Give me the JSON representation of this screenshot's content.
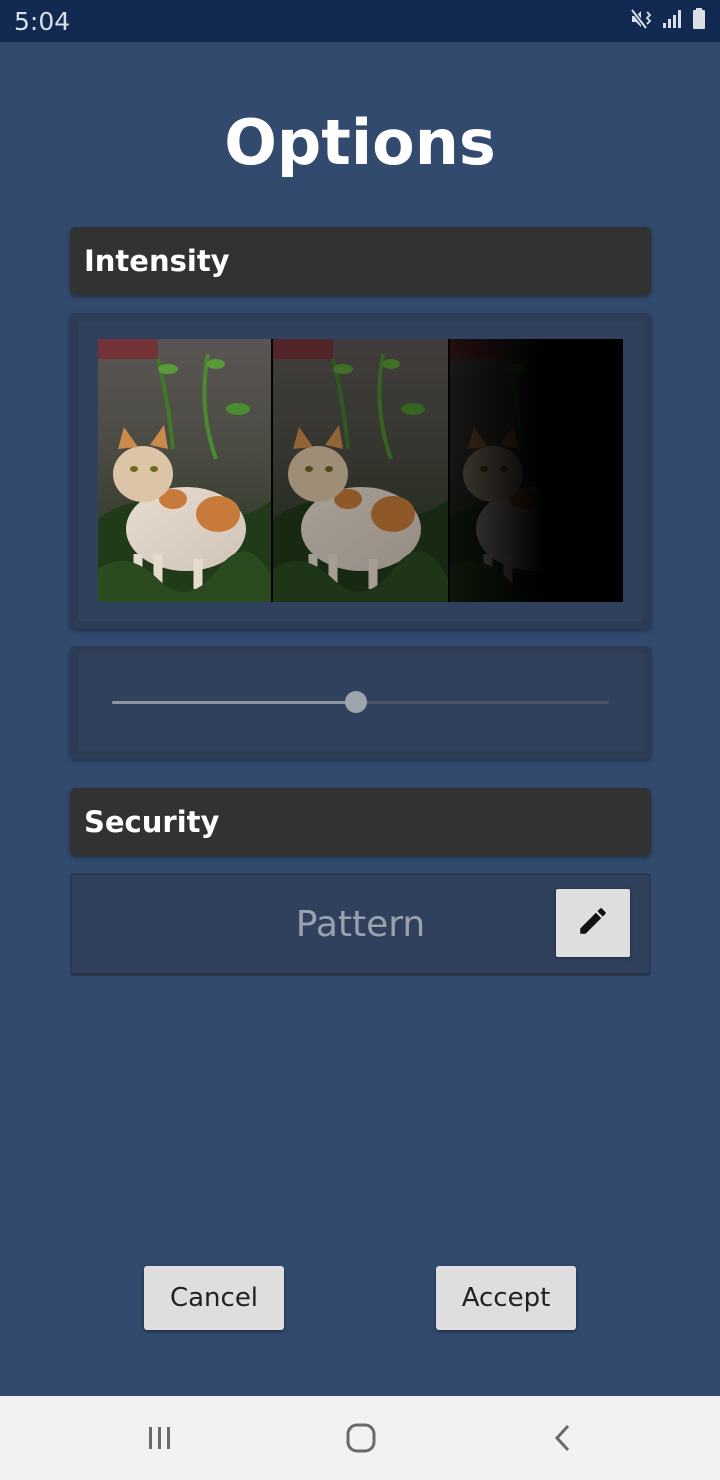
{
  "status_bar": {
    "time": "5:04",
    "icons": [
      "mute-vibrate-icon",
      "signal-icon",
      "battery-icon"
    ]
  },
  "title": "Options",
  "intensity": {
    "header": "Intensity",
    "preview_image": "cat-photo-intensity-preview",
    "slider_value": 0.49
  },
  "security": {
    "header": "Security",
    "value": "Pattern",
    "edit_icon": "pencil-icon"
  },
  "actions": {
    "cancel_label": "Cancel",
    "accept_label": "Accept"
  },
  "nav_bar": {
    "icons": [
      "recent-apps-icon",
      "home-icon",
      "back-icon"
    ]
  },
  "colors": {
    "background": "#324a6e",
    "status_bar": "#122a52",
    "header_bg": "#323232",
    "panel_bg": "#30415d"
  }
}
